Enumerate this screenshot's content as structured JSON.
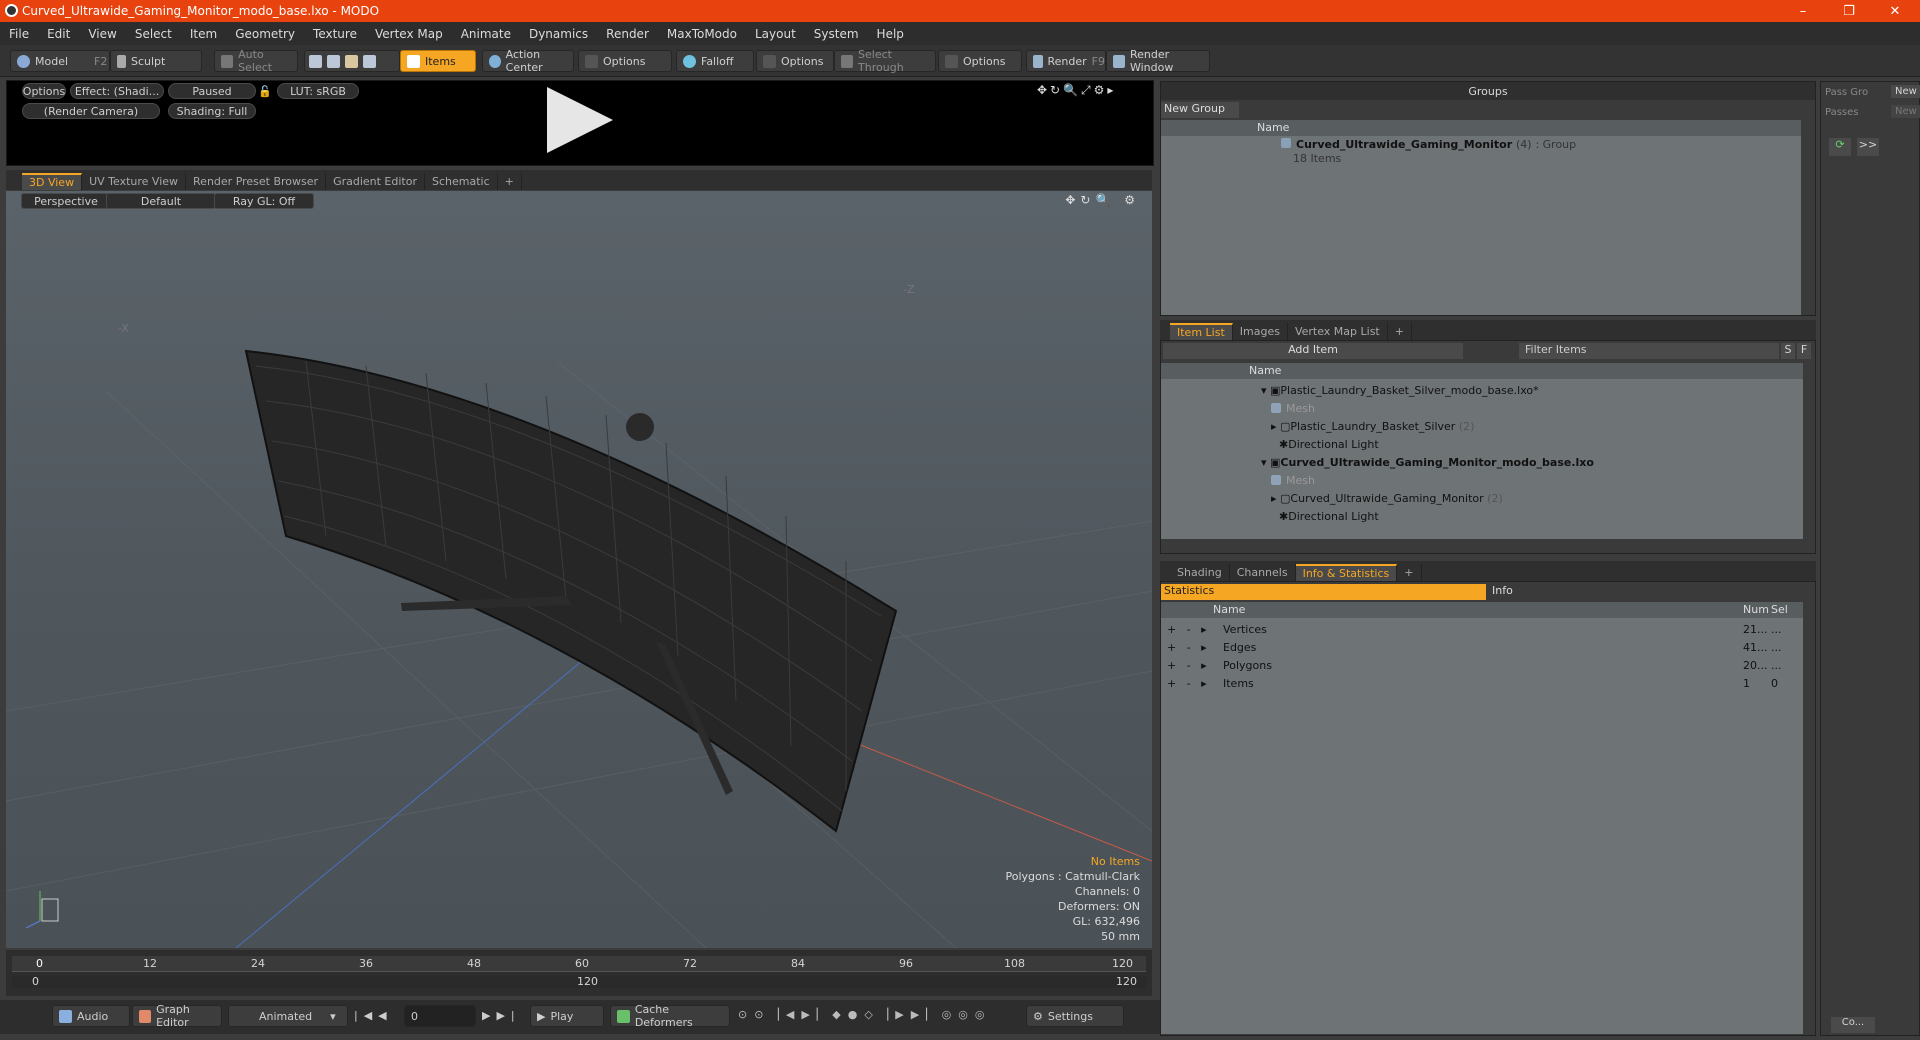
{
  "window": {
    "title": "Curved_Ultrawide_Gaming_Monitor_modo_base.lxo - MODO",
    "controls": [
      "–",
      "❐",
      "✕"
    ]
  },
  "menu": [
    "File",
    "Edit",
    "View",
    "Select",
    "Item",
    "Geometry",
    "Texture",
    "Vertex Map",
    "Animate",
    "Dynamics",
    "Render",
    "MaxToModo",
    "Layout",
    "System",
    "Help"
  ],
  "toolbar": {
    "model": "Model",
    "model_key": "F2",
    "sculpt": "Sculpt",
    "auto_select": "Auto Select",
    "items": "Items",
    "action_center": "Action Center",
    "options1": "Options",
    "falloff": "Falloff",
    "options2": "Options",
    "select_through": "Select Through",
    "options3": "Options",
    "render": "Render",
    "render_key": "F9",
    "render_window": "Render Window"
  },
  "preview": {
    "options": "Options",
    "effect": "Effect: (Shadi...",
    "paused": "Paused",
    "lut": "LUT: sRGB",
    "camera": "(Render Camera)",
    "shading": "Shading: Full"
  },
  "viewport_tabs": [
    "3D View",
    "UV Texture View",
    "Render Preset Browser",
    "Gradient Editor",
    "Schematic",
    "+"
  ],
  "viewport": {
    "projection": "Perspective",
    "style": "Default",
    "raygl": "Ray GL: Off",
    "axis_x": "-X",
    "axis_z": "-Z",
    "hud": {
      "selection": "No Items",
      "polygons": "Polygons : Catmull-Clark",
      "channels": "Channels: 0",
      "deformers": "Deformers: ON",
      "gl": "GL: 632,496",
      "lens": "50 mm"
    }
  },
  "timeline": {
    "ticks": [
      "0",
      "12",
      "24",
      "36",
      "48",
      "60",
      "72",
      "84",
      "96",
      "108",
      "120"
    ],
    "range_start": "0",
    "range_mid": "120",
    "range_end": "120"
  },
  "bottom": {
    "audio": "Audio",
    "graph_editor": "Graph Editor",
    "animated": "Animated",
    "frame": "0",
    "play": "Play",
    "cache": "Cache Deformers",
    "settings": "Settings"
  },
  "groups": {
    "title": "Groups",
    "new_group": "New Group",
    "col_name": "Name",
    "group_name": "Curved_Ultrawide_Gaming_Monitor",
    "group_count": "(4)",
    "group_type": ": Group",
    "group_items": "18 Items"
  },
  "passes": {
    "pass_groups": "Pass Gro",
    "passes": "Passes",
    "new1": "New",
    "new2": "New",
    "next": ">>"
  },
  "itemlist": {
    "tabs": [
      "Item List",
      "Images",
      "Vertex Map List",
      "+"
    ],
    "add_item": "Add Item",
    "filter": "Filter Items",
    "s": "S",
    "f": "F",
    "col_name": "Name",
    "rows": [
      {
        "label": "Plastic_Laundry_Basket_Silver_modo_base.lxo*",
        "count": "",
        "bold": false,
        "dim": false
      },
      {
        "label": "Mesh",
        "count": "",
        "bold": false,
        "dim": true
      },
      {
        "label": "Plastic_Laundry_Basket_Silver",
        "count": "(2)",
        "bold": false,
        "dim": false
      },
      {
        "label": "Directional Light",
        "count": "",
        "bold": false,
        "dim": false
      },
      {
        "label": "Curved_Ultrawide_Gaming_Monitor_modo_base.lxo",
        "count": "",
        "bold": true,
        "dim": false
      },
      {
        "label": "Mesh",
        "count": "",
        "bold": false,
        "dim": true
      },
      {
        "label": "Curved_Ultrawide_Gaming_Monitor",
        "count": "(2)",
        "bold": false,
        "dim": false
      },
      {
        "label": "Directional Light",
        "count": "",
        "bold": false,
        "dim": false
      }
    ]
  },
  "stats": {
    "tabs": [
      "Shading",
      "Channels",
      "Info & Statistics",
      "+"
    ],
    "statistics": "Statistics",
    "info": "Info",
    "col_name": "Name",
    "col_num": "Num",
    "col_sel": "Sel",
    "rows": [
      {
        "name": "Vertices",
        "num": "21...",
        "sel": "..."
      },
      {
        "name": "Edges",
        "num": "41...",
        "sel": "..."
      },
      {
        "name": "Polygons",
        "num": "20...",
        "sel": "..."
      },
      {
        "name": "Items",
        "num": "1",
        "sel": "0"
      }
    ]
  },
  "right_bottom": {
    "co": "Co..."
  }
}
